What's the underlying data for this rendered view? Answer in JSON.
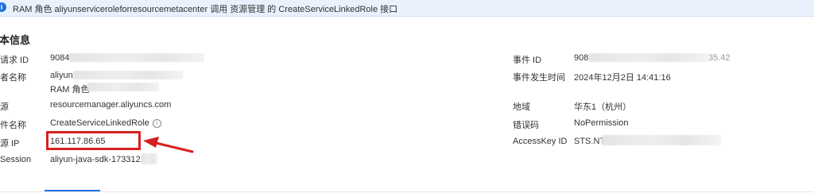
{
  "banner": {
    "text": "RAM 角色 aliyunserviceroleforresourcemetacenter 调用 资源管理 的 CreateServiceLinkedRole 接口"
  },
  "section": {
    "title": "本信息"
  },
  "left": {
    "request_id_label": "请求 ID",
    "request_id_value": "9084",
    "operator_label": "者名称",
    "operator_value": "aliyun",
    "operator_role": "RAM 角色",
    "source_label": "源",
    "source_value": "resourcemanager.aliyuncs.com",
    "event_name_label": "件名称",
    "event_name_value": "CreateServiceLinkedRole",
    "source_ip_label": "源 IP",
    "source_ip_value": "161.117.86.65",
    "session_label": "Session",
    "session_value": "aliyun-java-sdk-173312167"
  },
  "right": {
    "event_id_label": "事件 ID",
    "event_id_value": "908",
    "event_id_suffix": "35.42",
    "event_time_label": "事件发生时间",
    "event_time_value": "2024年12月2日 14:41:16",
    "region_label": "地域",
    "region_value": "华东1（杭州）",
    "error_code_label": "错误码",
    "error_code_value": "NoPermission",
    "accesskey_label": "AccessKey ID",
    "accesskey_value": "STS.NT"
  },
  "colors": {
    "annotation": "#d92020",
    "accent": "#1f6fe0",
    "banner_bg": "#e8f1fc"
  }
}
